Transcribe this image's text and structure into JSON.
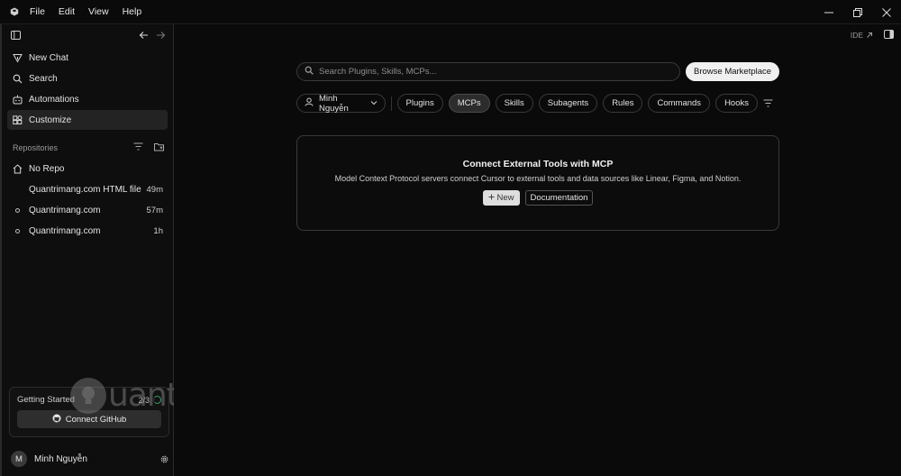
{
  "menu": [
    "File",
    "Edit",
    "View",
    "Help"
  ],
  "sidebar": {
    "nav": [
      {
        "label": "New Chat",
        "icon": "new-chat-icon"
      },
      {
        "label": "Search",
        "icon": "search-icon"
      },
      {
        "label": "Automations",
        "icon": "automations-icon"
      },
      {
        "label": "Customize",
        "icon": "customize-icon",
        "active": true
      }
    ],
    "repositories_title": "Repositories",
    "repos": [
      {
        "name": "No Repo",
        "time": ""
      },
      {
        "name": "Quantrimang.com HTML file",
        "time": "49m"
      },
      {
        "name": "Quantrimang.com",
        "time": "57m"
      },
      {
        "name": "Quantrimang.com",
        "time": "1h"
      }
    ],
    "getting_started": {
      "title": "Getting Started",
      "count": "2/3",
      "button": "Connect GitHub"
    },
    "user": {
      "initial": "M",
      "name": "Minh Nguyễn"
    }
  },
  "main": {
    "ide_label": "IDE",
    "search_placeholder": "Search Plugins, Skills, MCPs...",
    "browse_label": "Browse Marketplace",
    "user_filter": "Minh Nguyễn",
    "tabs": [
      "Plugins",
      "MCPs",
      "Skills",
      "Subagents",
      "Rules",
      "Commands",
      "Hooks"
    ],
    "active_tab": "MCPs",
    "card": {
      "title": "Connect External Tools with MCP",
      "description": "Model Context Protocol servers connect Cursor to external tools and data sources like Linear, Figma, and Notion.",
      "new_label": "New",
      "doc_label": "Documentation"
    }
  },
  "watermark": "uantrimang"
}
